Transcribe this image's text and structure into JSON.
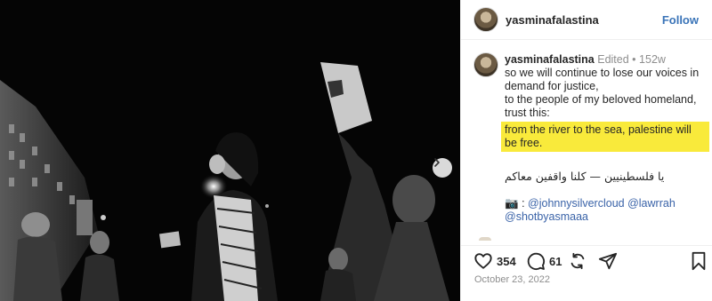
{
  "post": {
    "username": "yasminafalastina",
    "follow_label": "Follow",
    "caption_username": "yasminafalastina",
    "edited_label": "Edited",
    "separator": "•",
    "age": "152w",
    "caption_lines": [
      "so we will continue to lose our voices in",
      "demand for justice,",
      "to the people of my beloved homeland,",
      "trust this:"
    ],
    "highlighted_text": "from the river to the sea, palestine will be free.",
    "arabic_text": "يا فلسطينيين — كلنا واقفين معاكم",
    "camera_emoji": "📷",
    "credits_prefix": ":",
    "mentions": [
      "@johnnysilvercloud",
      "@lawrrah",
      "@shotbyasmaaa"
    ],
    "likes": "354",
    "comments": "61",
    "date": "October 23, 2022"
  },
  "colors": {
    "highlight": "#f9ea3b",
    "link": "#3a63a8",
    "follow": "#3a74b8",
    "muted": "#8e8e8e"
  },
  "icons": {
    "next": "chevron-right-icon",
    "like": "heart-icon",
    "comment": "comment-icon",
    "repost": "repost-icon",
    "share": "share-icon",
    "save": "bookmark-icon"
  }
}
